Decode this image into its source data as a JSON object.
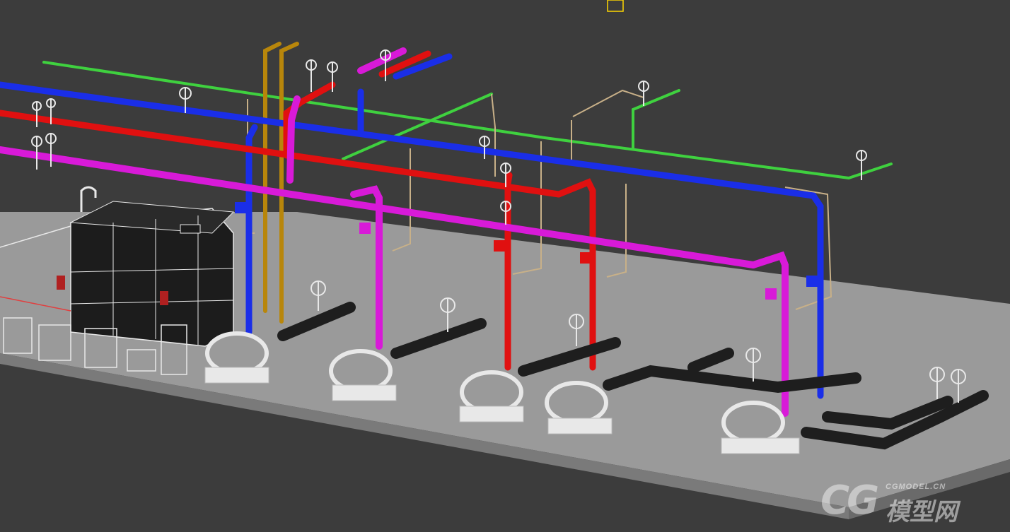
{
  "scene": {
    "description_free": true,
    "colors": {
      "background": "#3c3c3c",
      "floor": "#9a9a9a",
      "floor_edge": "#7a7a7a",
      "pipe_green": "#3fd13f",
      "pipe_blue": "#1a2ee8",
      "pipe_red": "#e01010",
      "pipe_magenta": "#d81ad8",
      "pipe_gold": "#b8860b",
      "pipe_tan": "#c8b088",
      "pipe_black": "#1e1e1e",
      "equipment_white": "#e8e8e8",
      "tank_dark": "#1c1c1c"
    }
  },
  "watermark": {
    "logo": "CG",
    "site": "CGMODEL.CN",
    "name": "模型网"
  }
}
